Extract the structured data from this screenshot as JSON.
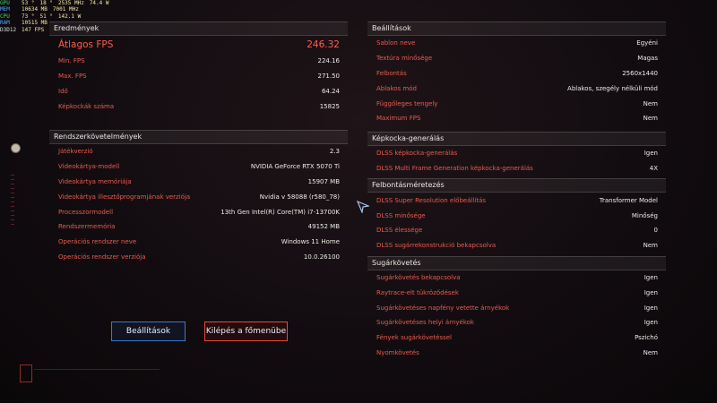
{
  "osd": {
    "rows": [
      {
        "key": "GPU",
        "a": "53 °",
        "b": "18 °",
        "c": "2535 MHz",
        "d": "74.4 W"
      },
      {
        "key": "MEM",
        "a": "10634 MB",
        "b": "7001 MHz",
        "c": "",
        "d": ""
      },
      {
        "key": "CPU",
        "a": "73 °",
        "b": "51 °",
        "c": "142.1 W",
        "d": ""
      },
      {
        "key": "RAM",
        "a": "10515 MB",
        "b": "",
        "c": "",
        "d": ""
      },
      {
        "key": "D3D12",
        "a": "147 FPS",
        "b": "",
        "c": "",
        "d": ""
      }
    ]
  },
  "results": {
    "title": "Eredmények",
    "headline": {
      "label": "Átlagos FPS",
      "value": "246.32"
    },
    "rows": [
      {
        "label": "Min. FPS",
        "value": "224.16"
      },
      {
        "label": "Max. FPS",
        "value": "271.50"
      },
      {
        "label": "Idő",
        "value": "64.24"
      },
      {
        "label": "Képkockák száma",
        "value": "15825"
      }
    ]
  },
  "system": {
    "title": "Rendszerkövetelmények",
    "rows": [
      {
        "label": "Játékverzió",
        "value": "2.3"
      },
      {
        "label": "Videokártya-modell",
        "value": "NVIDIA GeForce RTX 5070 Ti"
      },
      {
        "label": "Videokártya memóriája",
        "value": "15907 MB"
      },
      {
        "label": "Videokártya illesztőprogramjának verziója",
        "value": "Nvidia v 58088 (r580_78)"
      },
      {
        "label": "Processzormodell",
        "value": "13th Gen Intel(R) Core(TM) i7-13700K"
      },
      {
        "label": "Rendszermemória",
        "value": "49152 MB"
      },
      {
        "label": "Operációs rendszer neve",
        "value": "Windows 11 Home"
      },
      {
        "label": "Operációs rendszer verziója",
        "value": "10.0.26100"
      }
    ]
  },
  "buttons": {
    "settings": "Beállítások",
    "exit": "Kilépés a főmenübe"
  },
  "settings": {
    "title": "Beállítások",
    "rows": [
      {
        "label": "Sablon neve",
        "value": "Egyéni"
      },
      {
        "label": "Textúra minősége",
        "value": "Magas"
      },
      {
        "label": "Felbontás",
        "value": "2560x1440"
      },
      {
        "label": "Ablakos mód",
        "value": "Ablakos, szegély nélküli mód"
      },
      {
        "label": "Függőleges tengely",
        "value": "Nem"
      },
      {
        "label": "Maximum FPS",
        "value": "Nem"
      }
    ]
  },
  "framegen": {
    "title": "Képkocka-generálás",
    "rows": [
      {
        "label": "DLSS képkocka-generálás",
        "value": "Igen"
      },
      {
        "label": "DLSS Multi Frame Generation képkocka-generálás",
        "value": "4X"
      }
    ]
  },
  "upscaling": {
    "title": "Felbontásméretezés",
    "rows": [
      {
        "label": "DLSS Super Resolution előbeállítás",
        "value": "Transformer Model"
      },
      {
        "label": "DLSS minősége",
        "value": "Minőség"
      },
      {
        "label": "DLSS élessége",
        "value": "0"
      },
      {
        "label": "DLSS sugárrekonstrukció bekapcsolva",
        "value": "Nem"
      }
    ]
  },
  "raytracing": {
    "title": "Sugárkövetés",
    "rows": [
      {
        "label": "Sugárkövetés bekapcsolva",
        "value": "Igen"
      },
      {
        "label": "Raytrace-elt tükröződések",
        "value": "Igen"
      },
      {
        "label": "Sugárkövetéses napfény vetette árnyékok",
        "value": "Igen"
      },
      {
        "label": "Sugárkövetéses helyi árnyékok",
        "value": "Igen"
      },
      {
        "label": "Fények sugárkövetéssel",
        "value": "Pszichó"
      },
      {
        "label": "Nyomkövetés",
        "value": "Nem"
      }
    ]
  },
  "colors": {
    "label": "#ea5b4f",
    "value": "#ecece6",
    "accent_blue": "#3f78c8",
    "accent_red": "#e24b3d"
  }
}
